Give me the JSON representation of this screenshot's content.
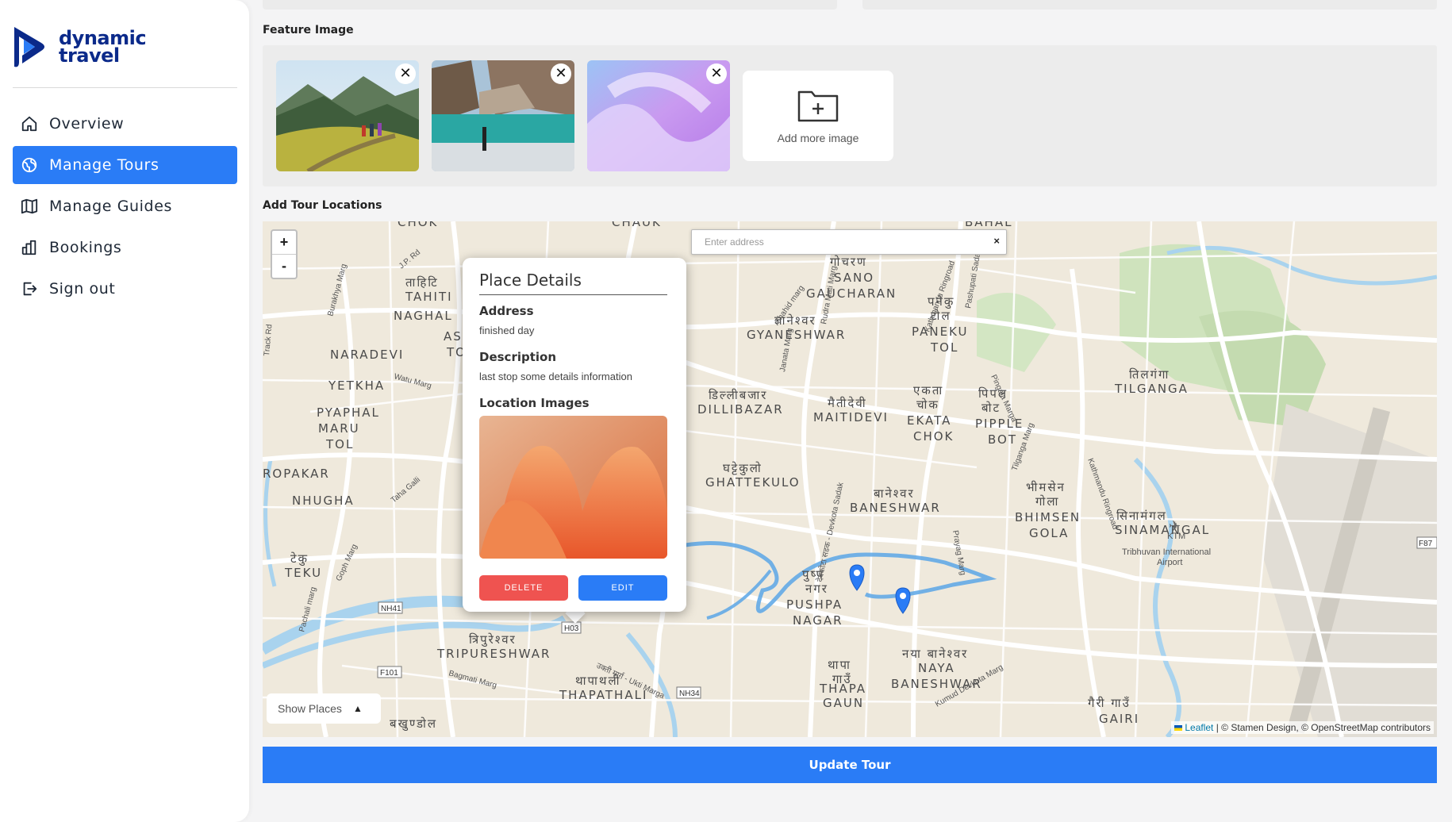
{
  "brand": {
    "name_line1": "dynamic",
    "name_line2": "travel"
  },
  "sidebar": {
    "items": [
      {
        "label": "Overview",
        "icon": "home-icon",
        "active": false
      },
      {
        "label": "Manage Tours",
        "icon": "globe-icon",
        "active": true
      },
      {
        "label": "Manage Guides",
        "icon": "map-book-icon",
        "active": false
      },
      {
        "label": "Bookings",
        "icon": "bar-chart-icon",
        "active": false
      },
      {
        "label": "Sign out",
        "icon": "sign-out-icon",
        "active": false
      }
    ]
  },
  "feature_image": {
    "label": "Feature Image",
    "images": [
      "mountain-hikers",
      "glacier-lake-trekker",
      "purple-abstract"
    ],
    "add_more_label": "Add more image"
  },
  "locations": {
    "label": "Add Tour Locations",
    "search_placeholder": "Enter address",
    "clear_label": "×",
    "zoom_in": "+",
    "zoom_out": "-",
    "show_places_label": "Show Places",
    "attribution_link": "Leaflet",
    "attribution_text": "| © Stamen Design, © OpenStreetMap contributors",
    "map_labels": {
      "chok": "CHOK",
      "chauk": "CHAUK",
      "bahal": "BAHAL",
      "tahiti_np": "ताहिटि",
      "tahiti": "TAHITI",
      "naghal": "NAGHAL",
      "asan": "ASA",
      "to": "TO",
      "naradevi": "NARADEVI",
      "yetkha": "YETKHA",
      "pyaphal": "PYAPHAL",
      "maru": "MARU",
      "tol": "TOL",
      "ropakar": "ROPAKAR",
      "nhugha": "NHUGHA",
      "teku_np": "टेकु",
      "teku": "TEKU",
      "gaucharan_np": "गोचरण",
      "sano": "SANO",
      "gaucharan": "GAUCHARAN",
      "gyaneshwar_np": "ज्ञानेश्वर",
      "gyaneshwar": "GYANESHWAR",
      "paneku_np1": "पनेकु",
      "paneku_np2": "टोल",
      "paneku": "PANEKU",
      "paneku_tol": "TOL",
      "dillibazar_np": "डिल्लीबजार",
      "dillibazar": "DILLIBAZAR",
      "maitidevi_np": "मैतीदेवी",
      "maitidevi": "MAITIDEVI",
      "ekata_np1": "एकता",
      "ekata_np2": "चोक",
      "ekata": "EKATA",
      "chok2": "CHOK",
      "pipple_np1": "पिपल",
      "pipple_np2": "बोट",
      "pipple": "PIPPLE",
      "bot": "BOT",
      "tilganga_np": "तिलगंगा",
      "tilganga": "TILGANGA",
      "ghattekulo_np": "घट्टेकुलो",
      "ghattekulo": "GHATTEKULO",
      "baneshwar_np": "बानेश्वर",
      "baneshwar": "BANESHWAR",
      "bhimsen_np1": "भीमसेन",
      "bhimsen_np2": "गोला",
      "bhimsen": "BHIMSEN",
      "gola": "GOLA",
      "sinamangal_np": "सिनामंगल",
      "sinamangal": "SINAMANGAL",
      "pushpa_np1": "पुष्प",
      "pushpa_np2": "नगर",
      "pushpa": "PUSHPA",
      "nagar": "NAGAR",
      "tripureshwar_np": "त्रिपुरेश्वर",
      "tripureshwar": "TRIPURESHWAR",
      "thapathali_np": "थापाथली",
      "thapathali": "THAPATHALI",
      "thapa_np1": "थापा",
      "thapa_np2": "गाउँ",
      "thapa": "THAPA",
      "gaun": "GAUN",
      "naya_np": "नया बानेश्वर",
      "naya": "NAYA",
      "naya_baneshwar": "BANESHWAR",
      "gairi_np": "गैरी गाउँ",
      "gairi": "GAIRI",
      "bakhundol_np": "बखुण्डोल",
      "ktm": "KTM",
      "airport1": "Tribhuvan International",
      "airport2": "Airport",
      "r_jp": "J.P. Rd",
      "r_burakhya": "Burakhya Marg",
      "r_watu": "Watu Marg",
      "r_ringroad1": "Kathmandu Ringroad",
      "r_pashupati": "Pashupati Sadak",
      "r_shahid": "Shahid marg",
      "r_rudra": "Rudra Mati Marg",
      "r_janata": "Janata Marg",
      "r_pingala": "Pingala Marga",
      "r_tilganga": "Tilganga Marg",
      "r_ringroad2": "Kathmandu Ringroad",
      "r_devkota": "देवकोटा सडक - Devkota Sadak",
      "r_prayag": "Prayag Marg",
      "r_bagmati": "Bagmati Marg",
      "r_ukti": "उक्ती मार्ग - Ukti Marga",
      "r_kumud": "Kumud Devkota Marg",
      "r_pachali": "Pachali marg",
      "r_goph": "Goph Marg",
      "r_taha": "Taha Galli",
      "r_track": "Track Rd",
      "s_nh41": "NH41",
      "s_h03": "H03",
      "s_f101": "F101",
      "s_nh34": "NH34",
      "s_f87": "F87"
    }
  },
  "popup": {
    "title": "Place Details",
    "address_label": "Address",
    "address_value": "finished day",
    "description_label": "Description",
    "description_value": "last stop some details information",
    "images_label": "Location Images",
    "delete_label": "DELETE",
    "edit_label": "EDIT"
  },
  "actions": {
    "update_label": "Update Tour"
  },
  "colors": {
    "accent": "#2a7cf6",
    "danger": "#ef5350",
    "brand": "#0b2a8a",
    "route": "#5aa6e6"
  }
}
